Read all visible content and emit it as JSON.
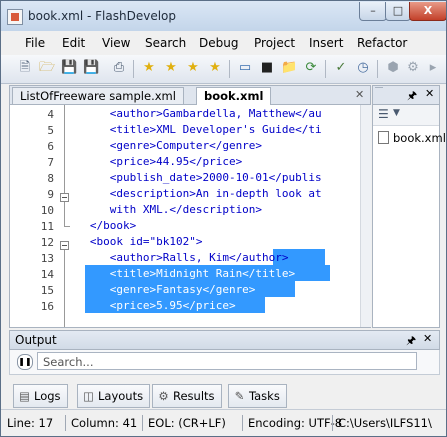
{
  "window": {
    "title": "book.xml - FlashDevelop",
    "close_glyph": "X"
  },
  "menu": [
    "File",
    "Edit",
    "View",
    "Search",
    "Debug",
    "Project",
    "Insert",
    "Refactor"
  ],
  "toolbar_icons": [
    "new-file-icon",
    "open-icon",
    "save-icon",
    "save-all-icon",
    "print-icon",
    "bookmark-star-icon",
    "bookmark-next-icon",
    "bookmark-prev-icon",
    "bookmark-clear-icon",
    "console-icon",
    "terminal-icon",
    "folder-icon",
    "refresh-icon",
    "check-icon",
    "clock-icon",
    "package-icon",
    "gear-icon"
  ],
  "editor": {
    "tabs": [
      {
        "label": "ListOfFreeware sample.xml",
        "active": false
      },
      {
        "label": "book.xml",
        "active": true
      }
    ],
    "line_numbers": [
      "4",
      "5",
      "6",
      "7",
      "8",
      "9",
      "10",
      "11",
      "12",
      "13",
      "14",
      "15",
      "16"
    ],
    "lines": [
      "      <author>Gambardella, Matthew</au",
      "      <title>XML Developer's Guide</ti",
      "      <genre>Computer</genre>",
      "      <price>44.95</price>",
      "      <publish_date>2000-10-01</publis",
      "      <description>An in-depth look at",
      "      with XML.</description>",
      "   </book>",
      "   <book id=\"bk102\">",
      "      <author>Ralls, Kim</author>",
      "      <title>Midnight Rain</title>",
      "      <genre>Fantasy</genre>",
      "      <price>5.95</price>"
    ]
  },
  "side_panel": {
    "tab": "",
    "file": "book.xml"
  },
  "output": {
    "title": "Output",
    "search_placeholder": "Search..."
  },
  "bottom_tabs": [
    {
      "label": "Logs",
      "icon": "logs-icon"
    },
    {
      "label": "Layouts",
      "icon": "layouts-icon"
    },
    {
      "label": "Results",
      "icon": "results-icon"
    },
    {
      "label": "Tasks",
      "icon": "tasks-icon"
    }
  ],
  "status": {
    "line": "Line: 17",
    "column": "Column: 41",
    "eol": "EOL: (CR+LF)",
    "encoding": "Encoding: UTF-8",
    "path": "C:\\Users\\ILFS11\\"
  }
}
